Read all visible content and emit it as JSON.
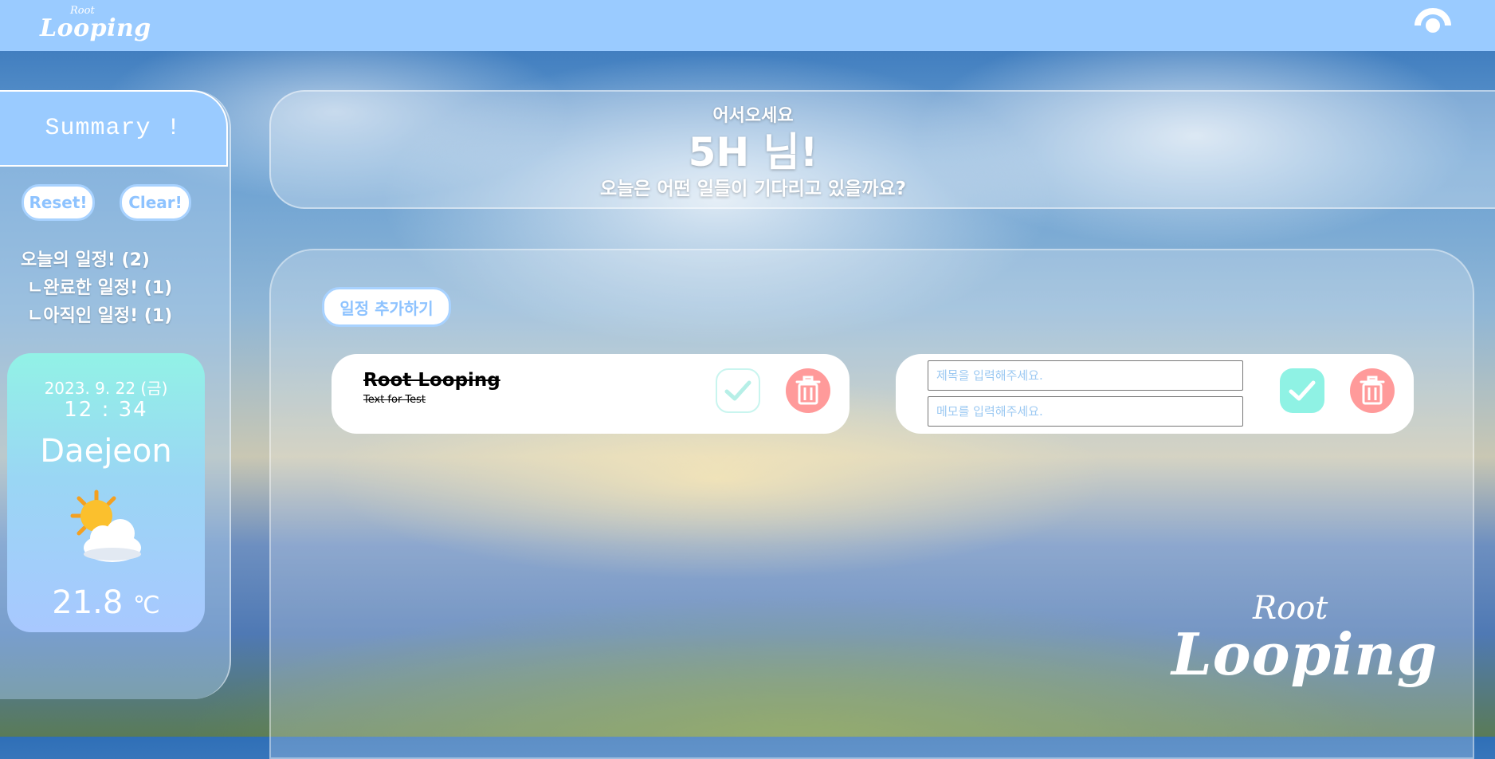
{
  "header": {
    "brand_root": "Root",
    "brand_looping": "Looping",
    "icon": "eye-icon"
  },
  "sidebar": {
    "title": "Summary !",
    "reset_label": "Reset!",
    "clear_label": "Clear!",
    "stats": {
      "today": "오늘의 일정! (2)",
      "done": "ㄴ완료한 일정! (1)",
      "pending": "ㄴ아직인 일정! (1)"
    },
    "weather": {
      "date": "2023. 9. 22 (금)",
      "time": "12 : 34",
      "city": "Daejeon",
      "icon": "sun-behind-cloud-icon",
      "temp": "21.8",
      "unit": "℃"
    }
  },
  "welcome": {
    "greeting": "어서오세요",
    "name": "5H 님!",
    "subtitle": "오늘은 어떤 일들이 기다리고 있을까요?"
  },
  "main": {
    "add_label": "일정 추가하기",
    "todo": {
      "title": "Root Looping",
      "memo": "Text for Test",
      "completed": true
    },
    "new_todo": {
      "title_placeholder": "제목을 입력해주세요.",
      "memo_placeholder": "메모를 입력해주세요.",
      "title_value": "",
      "memo_value": ""
    }
  },
  "footer_brand": {
    "root": "Root",
    "looping": "Looping"
  },
  "colors": {
    "topbar": "#9acbff",
    "accent_mint": "#8ff2e4",
    "delete_red": "#ff9a9a",
    "button_border": "#a8d2ff"
  }
}
